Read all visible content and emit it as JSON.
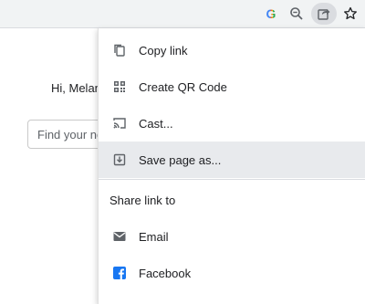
{
  "toolbar": {
    "google_letter": "G",
    "icons": [
      "google-icon",
      "zoom-out-icon",
      "share-icon",
      "star-icon"
    ]
  },
  "page": {
    "greeting": "Hi, Melanie",
    "search_placeholder": "Find your next"
  },
  "menu": {
    "items": [
      {
        "label": "Copy link",
        "icon": "copy-icon"
      },
      {
        "label": "Create QR Code",
        "icon": "qr-code-icon"
      },
      {
        "label": "Cast...",
        "icon": "cast-icon"
      },
      {
        "label": "Save page as...",
        "icon": "save-page-icon"
      }
    ],
    "share_header": "Share link to",
    "share_items": [
      {
        "label": "Email",
        "icon": "email-icon"
      },
      {
        "label": "Facebook",
        "icon": "facebook-icon"
      }
    ]
  },
  "colors": {
    "toolbar_bg": "#f1f3f4",
    "hover_bg": "#e8eaed",
    "facebook_blue": "#1877f2",
    "icon_gray": "#5f6368"
  }
}
